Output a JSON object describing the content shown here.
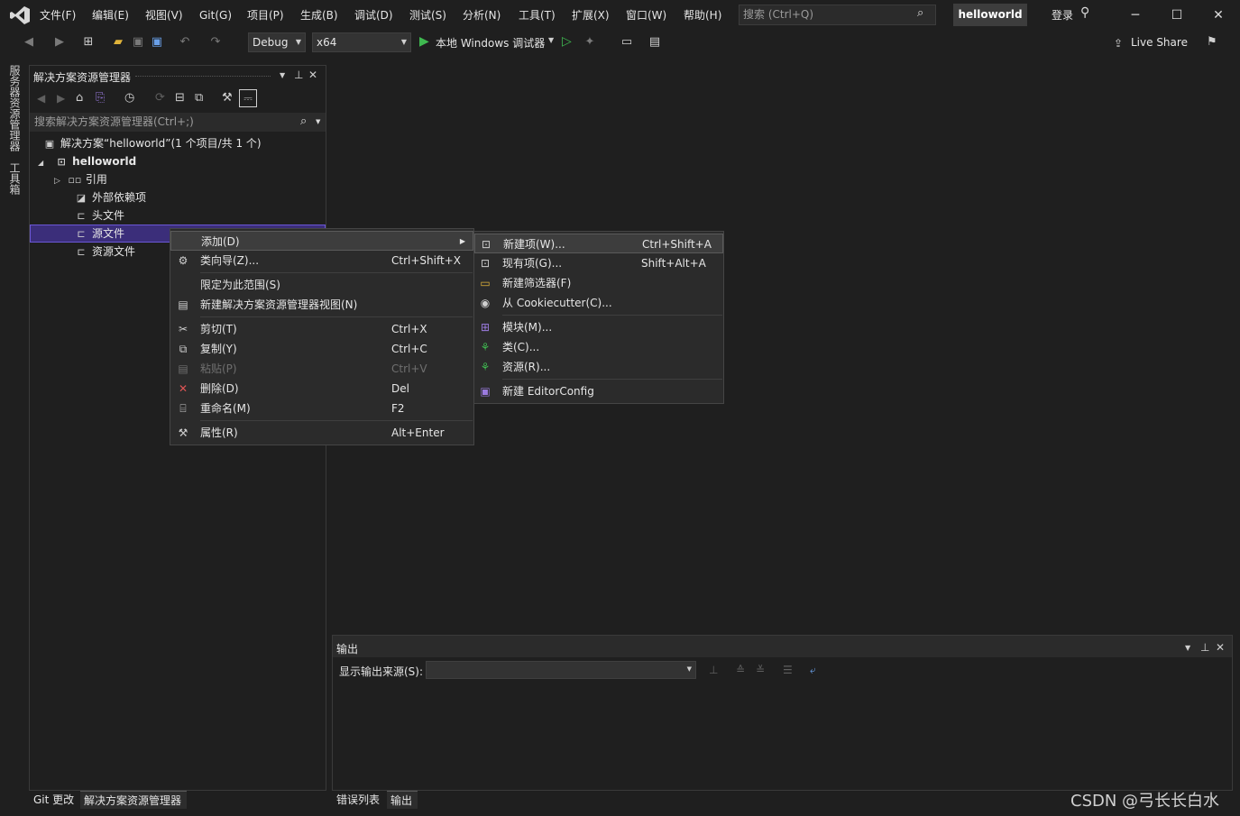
{
  "menubar": {
    "items": [
      "文件(F)",
      "编辑(E)",
      "视图(V)",
      "Git(G)",
      "项目(P)",
      "生成(B)",
      "调试(D)",
      "测试(S)",
      "分析(N)",
      "工具(T)",
      "扩展(X)",
      "窗口(W)",
      "帮助(H)"
    ],
    "search_placeholder": "搜索 (Ctrl+Q)",
    "solution_name": "helloworld",
    "login": "登录"
  },
  "toolbar": {
    "config": "Debug",
    "platform": "x64",
    "run_target": "本地 Windows 调试器",
    "live_share": "Live Share"
  },
  "left_tabs": [
    "服务器资源管理器",
    "工具箱"
  ],
  "solution_explorer": {
    "title": "解决方案资源管理器",
    "search_placeholder": "搜索解决方案资源管理器(Ctrl+;)",
    "solution_label": "解决方案“helloworld”(1 个项目/共 1 个)",
    "project": "helloworld",
    "nodes": [
      "引用",
      "外部依赖项",
      "头文件",
      "源文件",
      "资源文件"
    ]
  },
  "bottom_tabs_left": [
    "Git 更改",
    "解决方案资源管理器"
  ],
  "bottom_tabs_right": [
    "错误列表",
    "输出"
  ],
  "output": {
    "title": "输出",
    "source_label": "显示输出来源(S):"
  },
  "context_menu": [
    {
      "label": "添加(D)",
      "shortcut": "",
      "icon": "",
      "submenu_arrow": "▶"
    },
    {
      "label": "类向导(Z)...",
      "shortcut": "Ctrl+Shift+X",
      "icon": "class-wizard-icon"
    },
    {
      "label": "限定为此范围(S)",
      "shortcut": "",
      "icon": ""
    },
    {
      "label": "新建解决方案资源管理器视图(N)",
      "shortcut": "",
      "icon": "new-view-icon"
    },
    {
      "label": "剪切(T)",
      "shortcut": "Ctrl+X",
      "icon": "cut-icon"
    },
    {
      "label": "复制(Y)",
      "shortcut": "Ctrl+C",
      "icon": "copy-icon"
    },
    {
      "label": "粘贴(P)",
      "shortcut": "Ctrl+V",
      "icon": "paste-icon"
    },
    {
      "label": "删除(D)",
      "shortcut": "Del",
      "icon": "delete-icon"
    },
    {
      "label": "重命名(M)",
      "shortcut": "F2",
      "icon": "rename-icon"
    },
    {
      "label": "属性(R)",
      "shortcut": "Alt+Enter",
      "icon": "wrench-icon"
    }
  ],
  "submenu": [
    {
      "label": "新建项(W)...",
      "shortcut": "Ctrl+Shift+A",
      "icon": "new-item-icon"
    },
    {
      "label": "现有项(G)...",
      "shortcut": "Shift+Alt+A",
      "icon": "existing-item-icon"
    },
    {
      "label": "新建筛选器(F)",
      "shortcut": "",
      "icon": "new-filter-icon"
    },
    {
      "label": "从 Cookiecutter(C)...",
      "shortcut": "",
      "icon": "cookiecutter-icon"
    },
    {
      "label": "模块(M)...",
      "shortcut": "",
      "icon": "module-icon"
    },
    {
      "label": "类(C)...",
      "shortcut": "",
      "icon": "class-icon"
    },
    {
      "label": "资源(R)...",
      "shortcut": "",
      "icon": "resource-icon"
    },
    {
      "label": "新建 EditorConfig",
      "shortcut": "",
      "icon": "editorconfig-icon"
    }
  ],
  "watermark": "CSDN @弓长长白水",
  "colors": {
    "selection": "#3b2e7a",
    "selection_border": "#6b57d6",
    "run_green": "#3fb950",
    "delete_red": "#e05555",
    "accent_purple": "#9b7be0"
  }
}
